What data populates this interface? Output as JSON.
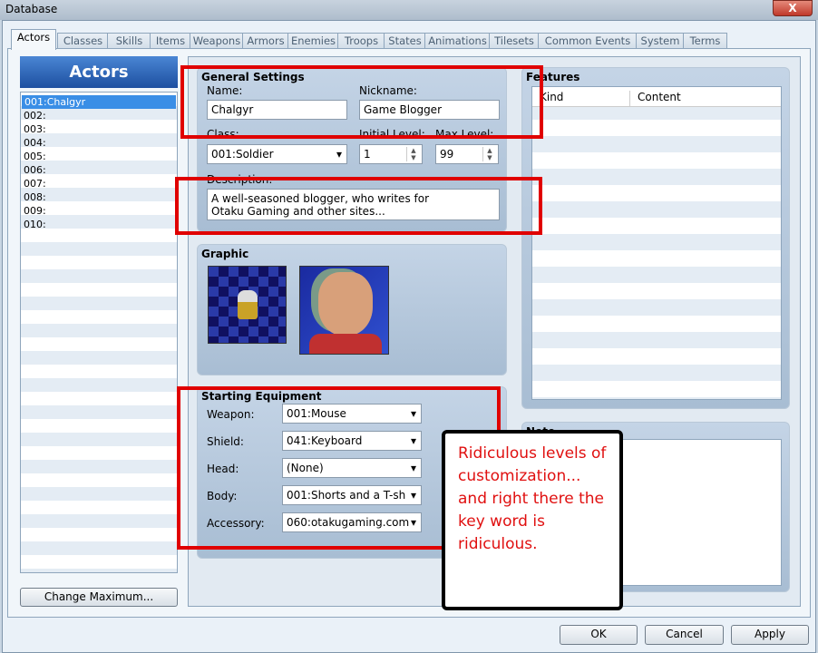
{
  "window": {
    "title": "Database",
    "close": "X"
  },
  "tabs": [
    "Actors",
    "Classes",
    "Skills",
    "Items",
    "Weapons",
    "Armors",
    "Enemies",
    "Troops",
    "States",
    "Animations",
    "Tilesets",
    "Common Events",
    "System",
    "Terms"
  ],
  "actors": {
    "header": "Actors",
    "items": [
      "001:Chalgyr",
      "002:",
      "003:",
      "004:",
      "005:",
      "006:",
      "007:",
      "008:",
      "009:",
      "010:"
    ],
    "change_max": "Change Maximum..."
  },
  "general": {
    "title": "General Settings",
    "name_label": "Name:",
    "name": "Chalgyr",
    "nick_label": "Nickname:",
    "nickname": "Game Blogger",
    "class_label": "Class:",
    "class": "001:Soldier",
    "init_label": "Initial Level:",
    "init": "1",
    "max_label": "Max Level:",
    "max": "99",
    "desc_label": "Description:",
    "desc1": "A well-seasoned blogger, who writes for",
    "desc2": "Otaku Gaming and other sites..."
  },
  "graphic": {
    "title": "Graphic"
  },
  "equipment": {
    "title": "Starting Equipment",
    "rows": [
      {
        "label": "Weapon:",
        "value": "001:Mouse"
      },
      {
        "label": "Shield:",
        "value": "041:Keyboard"
      },
      {
        "label": "Head:",
        "value": "(None)"
      },
      {
        "label": "Body:",
        "value": "001:Shorts and a T-sh"
      },
      {
        "label": "Accessory:",
        "value": "060:otakugaming.com"
      }
    ]
  },
  "features": {
    "title": "Features",
    "col_kind": "Kind",
    "col_content": "Content"
  },
  "note": {
    "title": "Note"
  },
  "callout": "Ridiculous levels of customization... and right there the key word is ridiculous.",
  "buttons": {
    "ok": "OK",
    "cancel": "Cancel",
    "apply": "Apply"
  }
}
